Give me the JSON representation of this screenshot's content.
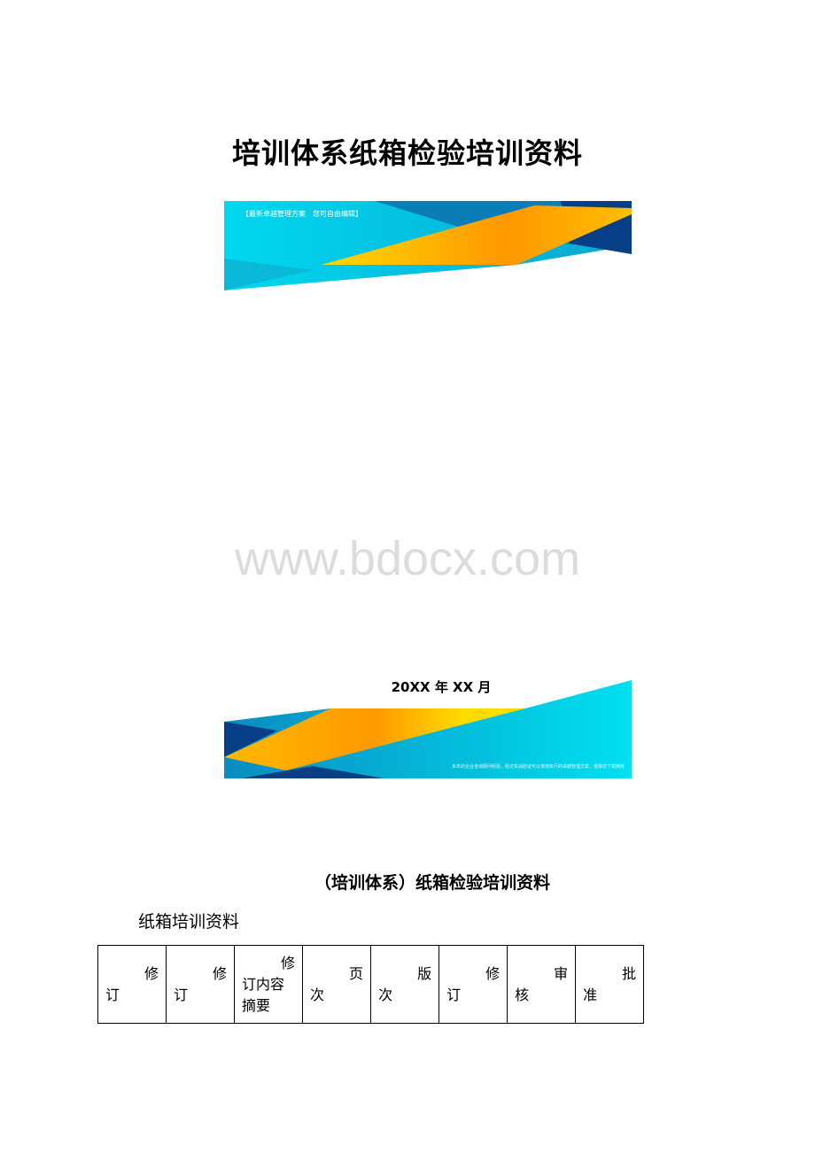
{
  "document": {
    "title": "培训体系纸箱检验培训资料",
    "cover_banner_tag": "【最新卓越管理方案　您可自由编辑】",
    "watermark": "www.bdocx.com",
    "date": "20XX 年 XX 月",
    "cover_banner_footer": "多年的企业咨询顾问经验，经过实战验证可以落地执行的卓越管理方案，值得您下载拥有",
    "subtitle": "（培训体系）纸箱检验培训资料",
    "section_heading": "纸箱培训资料",
    "table": {
      "headers": [
        "修订",
        "修订",
        "修订内容摘要",
        "页次",
        "版次",
        "修订",
        "审核",
        "批准"
      ]
    }
  },
  "colors": {
    "cyan": "#00d4ea",
    "blue": "#0a5fa0",
    "navy": "#063f86",
    "yellow": "#ffc400",
    "orange": "#ff9a00"
  }
}
